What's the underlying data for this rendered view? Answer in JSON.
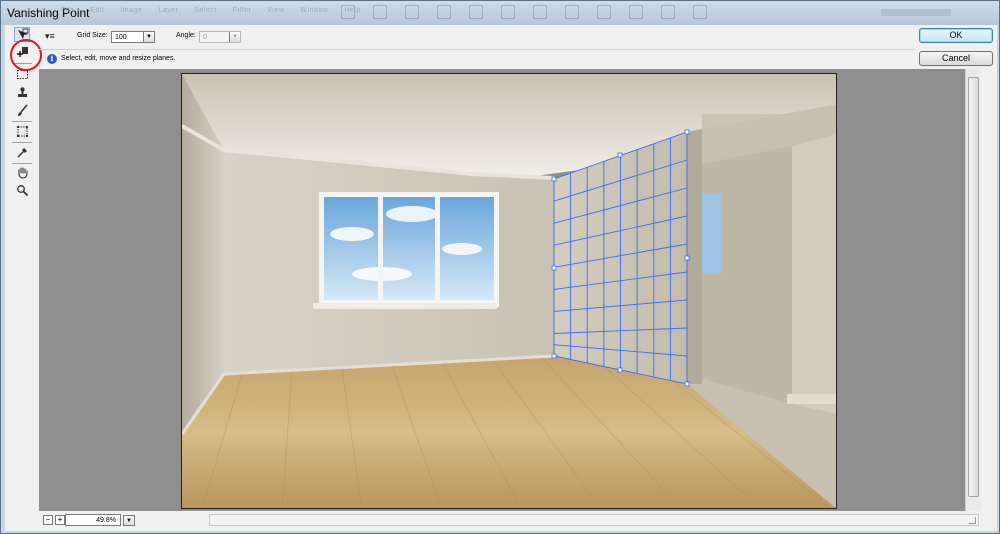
{
  "window": {
    "title": "Vanishing Point"
  },
  "ghost_menu": [
    "File",
    "Edit",
    "Image",
    "Layer",
    "Select",
    "Filter",
    "View",
    "Window",
    "Help"
  ],
  "options": {
    "grid_size_label": "Grid Size:",
    "grid_size_value": "100",
    "angle_label": "Angle:",
    "angle_value": "0",
    "info_text": "Select, edit, move and resize planes."
  },
  "buttons": {
    "ok": "OK",
    "cancel": "Cancel"
  },
  "tools": [
    {
      "name": "edit-plane-tool-icon",
      "active": true
    },
    {
      "name": "create-plane-tool-icon",
      "active": false
    },
    {
      "name": "marquee-tool-icon",
      "active": false
    },
    {
      "name": "stamp-tool-icon",
      "active": false
    },
    {
      "name": "brush-tool-icon",
      "active": false
    },
    {
      "name": "transform-tool-icon",
      "active": false
    },
    {
      "name": "eyedropper-tool-icon",
      "active": false
    },
    {
      "name": "hand-tool-icon",
      "active": false
    },
    {
      "name": "zoom-tool-icon",
      "active": false
    }
  ],
  "status": {
    "zoom_value": "49.8%",
    "zoom_out": "−",
    "zoom_in": "+"
  },
  "colors": {
    "grid_line": "#3a6cf2",
    "annotation_circle": "#e3161a",
    "ok_border": "#3c7fb1"
  }
}
